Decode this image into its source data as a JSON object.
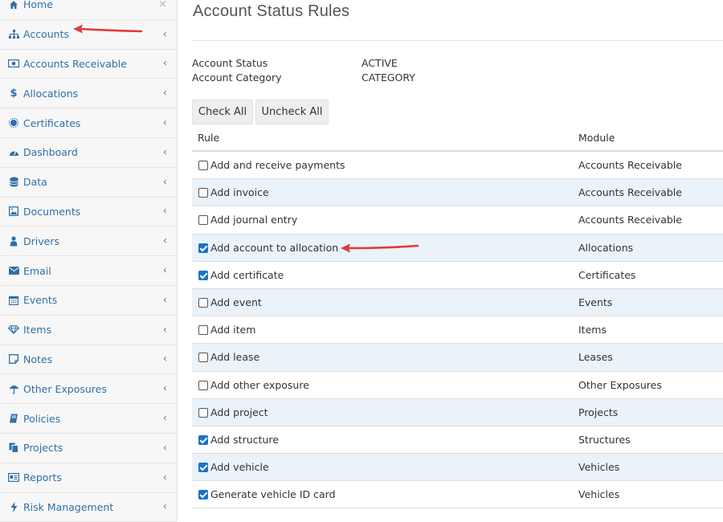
{
  "sidebar": {
    "items": [
      {
        "label": "Home",
        "icon": "home-icon"
      },
      {
        "label": "Accounts",
        "icon": "sitemap-icon"
      },
      {
        "label": "Accounts Receivable",
        "icon": "money-icon"
      },
      {
        "label": "Allocations",
        "icon": "dollar-icon"
      },
      {
        "label": "Certificates",
        "icon": "certificate-icon"
      },
      {
        "label": "Dashboard",
        "icon": "dashboard-icon"
      },
      {
        "label": "Data",
        "icon": "database-icon"
      },
      {
        "label": "Documents",
        "icon": "document-icon"
      },
      {
        "label": "Drivers",
        "icon": "driver-icon"
      },
      {
        "label": "Email",
        "icon": "envelope-icon"
      },
      {
        "label": "Events",
        "icon": "calendar-icon"
      },
      {
        "label": "Items",
        "icon": "diamond-icon"
      },
      {
        "label": "Notes",
        "icon": "note-icon"
      },
      {
        "label": "Other Exposures",
        "icon": "umbrella-icon"
      },
      {
        "label": "Policies",
        "icon": "book-icon"
      },
      {
        "label": "Projects",
        "icon": "projects-icon"
      },
      {
        "label": "Reports",
        "icon": "report-icon"
      },
      {
        "label": "Risk Management",
        "icon": "bolt-icon"
      }
    ]
  },
  "main": {
    "title": "Account Status Rules",
    "account_status_label": "Account Status",
    "account_status_value": "ACTIVE",
    "account_category_label": "Account Category",
    "account_category_value": "CATEGORY",
    "check_all_label": "Check All",
    "uncheck_all_label": "Uncheck All"
  },
  "table": {
    "headers": {
      "rule": "Rule",
      "module": "Module"
    },
    "rows": [
      {
        "rule": "Add and receive payments",
        "module": "Accounts Receivable",
        "checked": false
      },
      {
        "rule": "Add invoice",
        "module": "Accounts Receivable",
        "checked": false
      },
      {
        "rule": "Add journal entry",
        "module": "Accounts Receivable",
        "checked": false
      },
      {
        "rule": "Add account to allocation",
        "module": "Allocations",
        "checked": true
      },
      {
        "rule": "Add certificate",
        "module": "Certificates",
        "checked": true
      },
      {
        "rule": "Add event",
        "module": "Events",
        "checked": false
      },
      {
        "rule": "Add item",
        "module": "Items",
        "checked": false
      },
      {
        "rule": "Add lease",
        "module": "Leases",
        "checked": false
      },
      {
        "rule": "Add other exposure",
        "module": "Other Exposures",
        "checked": false
      },
      {
        "rule": "Add project",
        "module": "Projects",
        "checked": false
      },
      {
        "rule": "Add structure",
        "module": "Structures",
        "checked": true
      },
      {
        "rule": "Add vehicle",
        "module": "Vehicles",
        "checked": true
      },
      {
        "rule": "Generate vehicle ID card",
        "module": "Vehicles",
        "checked": true
      }
    ]
  },
  "colors": {
    "link": "#2f6fa8",
    "checkbox_checked": "#1a73c9",
    "row_alt": "#eaf2fa",
    "annotation_arrow": "#e03a3a"
  }
}
